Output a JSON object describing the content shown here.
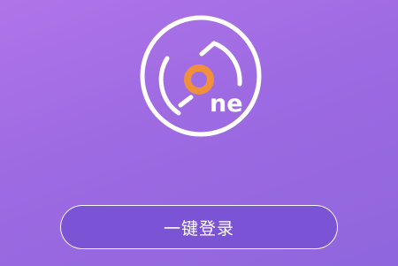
{
  "logo": {
    "text": "ne",
    "icon": "one-logo-icon",
    "ring_color": "#ffffff",
    "accent_color": "#f0903f"
  },
  "login_button": {
    "label": "一键登录"
  },
  "colors": {
    "background_top": "#b074e8",
    "background_bottom": "#8f66dd",
    "button_fill": "#7a54d4"
  }
}
